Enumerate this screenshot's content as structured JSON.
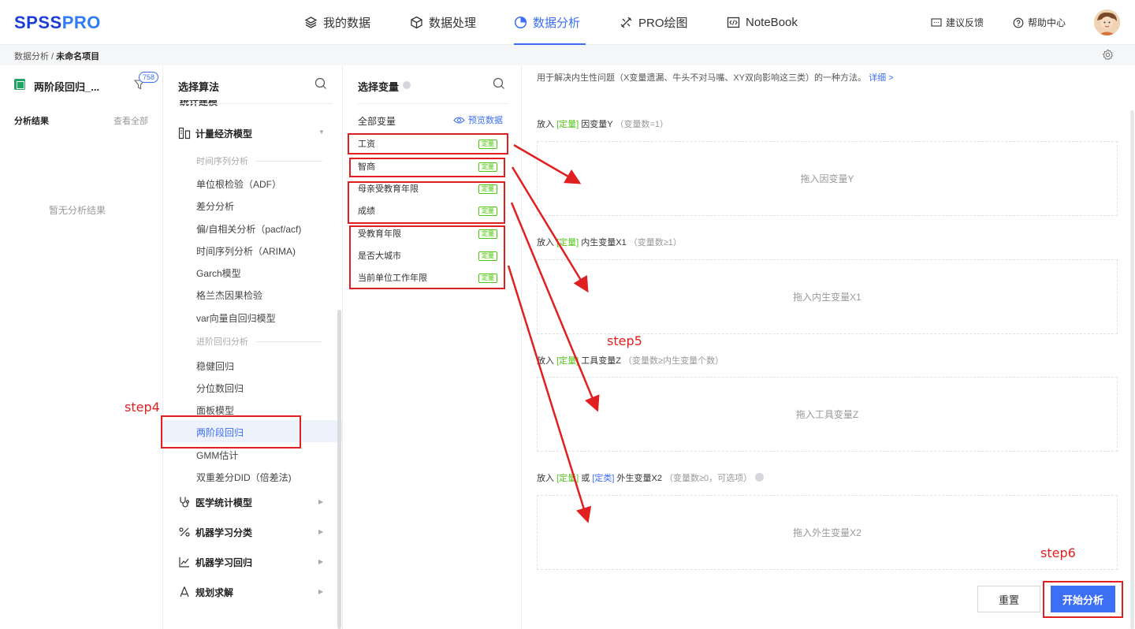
{
  "header": {
    "logo_a": "SPSS",
    "logo_b": "PRO",
    "nav": [
      "我的数据",
      "数据处理",
      "数据分析",
      "PRO绘图",
      "NoteBook"
    ],
    "feedback": "建议反馈",
    "help": "帮助中心"
  },
  "breadcrumb": {
    "parent": "数据分析 / ",
    "current": "未命名项目"
  },
  "left": {
    "project_name": "两阶段回归_...",
    "badge": "758",
    "results_title": "分析结果",
    "view_all": "查看全部",
    "empty": "暂无分析结果"
  },
  "algo": {
    "title": "选择算法",
    "partial_top": "统计建模",
    "category_main": "计量经济模型",
    "section_ts": "时间序列分析",
    "ts_items": [
      "单位根检验（ADF）",
      "差分分析",
      "偏/自相关分析（pacf/acf)",
      "时间序列分析（ARIMA)",
      "Garch模型",
      "格兰杰因果检验",
      "var向量自回归模型"
    ],
    "section_reg": "进阶回归分析",
    "reg_items": [
      "稳健回归",
      "分位数回归",
      "面板模型",
      "两阶段回归",
      "GMM估计",
      "双重差分DID（倍差法)"
    ],
    "categories": [
      "医学统计模型",
      "机器学习分类",
      "机器学习回归",
      "规划求解"
    ]
  },
  "vars": {
    "title": "选择变量",
    "all": "全部变量",
    "preview": "预览数据",
    "list": [
      "工资",
      "智商",
      "母亲受教育年限",
      "成绩",
      "受教育年限",
      "是否大城市",
      "当前单位工作年限"
    ],
    "tag": "定量"
  },
  "main": {
    "desc": "用于解决内生性问题（X变量遗漏、牛头不对马嘴、XY双向影响这三类）的一种方法。",
    "desc_link": "详细 >",
    "slots": [
      {
        "pre": "放入 ",
        "tag": "[定量]",
        "name": " 因变量Y",
        "hint": "（变量数=1）",
        "drop": "拖入因变量Y"
      },
      {
        "pre": "放入 ",
        "tag": "[定量]",
        "name": " 内生变量X1",
        "hint": "（变量数≥1）",
        "drop": "拖入内生变量X1"
      },
      {
        "pre": "放入 ",
        "tag": "[定量]",
        "name": " 工具变量Z",
        "hint": "（变量数≥内生变量个数）",
        "drop": "拖入工具变量Z"
      },
      {
        "pre": "放入 ",
        "tag": "[定量]",
        "mid": " 或 ",
        "tag2": "[定类]",
        "name": " 外生变量X2",
        "hint": "（变量数≥0，可选项）",
        "drop": "拖入外生变量X2"
      }
    ],
    "reset": "重置",
    "start": "开始分析"
  },
  "annotations": {
    "step4": "step4",
    "step5": "step5",
    "step6": "step6"
  },
  "colors": {
    "accent": "#3c6ef6",
    "quant_tag": "#52c41a",
    "annotation": "#e02020"
  }
}
